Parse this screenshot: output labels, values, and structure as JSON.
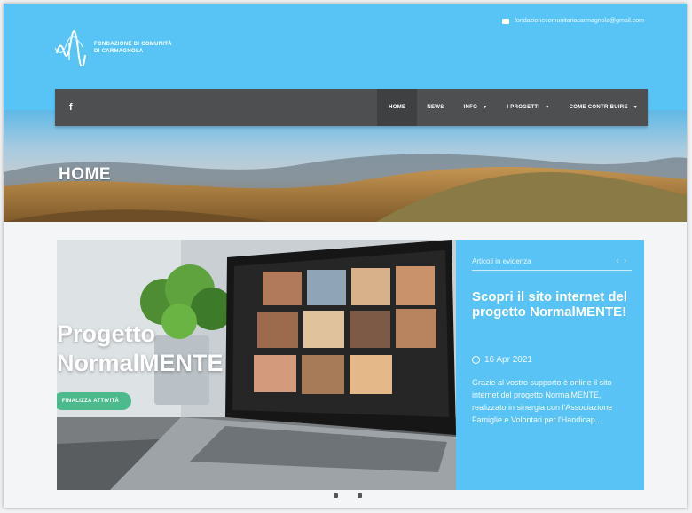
{
  "header": {
    "email": "fondazionecomunitariacarmagnola@gmail.com",
    "logo_line1": "FONDAZIONE DI COMUNITÀ",
    "logo_line2": "DI CARMAGNOLA",
    "accent_color": "#58c4f6"
  },
  "nav": {
    "facebook_label": "f",
    "items": [
      {
        "label": "HOME",
        "active": true
      },
      {
        "label": "NEWS"
      },
      {
        "label": "INFO",
        "has_dropdown": true
      },
      {
        "label": "I PROGETTI",
        "has_dropdown": true
      },
      {
        "label": "COME CONTRIBUIRE",
        "has_dropdown": true
      }
    ],
    "background_color": "#4e4f50"
  },
  "hero": {
    "title": "HOME"
  },
  "slider": {
    "title_line1": "Progetto",
    "title_line2": "NormalMENTE",
    "button_label": "FINALIZZA ATTIVITÀ"
  },
  "news": {
    "heading": "Articoli in evidenza",
    "arrow_prev": "‹",
    "arrow_next": "›",
    "title": "Scopri il sito internet del progetto NormalMENTE!",
    "date": "16 Apr 2021",
    "excerpt": "Grazie al vostro supporto è online il sito internet del progetto NormalMENTE, realizzato in sinergia con l'Associazione Famiglie e Volontari per l'Handicap..."
  }
}
